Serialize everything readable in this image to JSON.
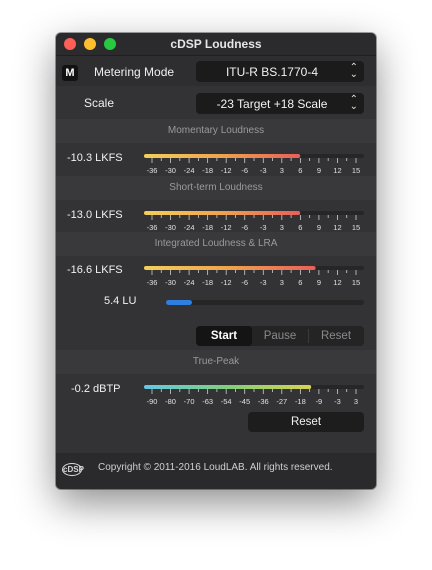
{
  "window": {
    "title": "cDSP Loudness"
  },
  "header": {
    "badge": "M",
    "metering_label": "Metering Mode",
    "metering_value": "ITU-R BS.1770-4",
    "scale_label": "Scale",
    "scale_value": "-23 Target +18 Scale"
  },
  "ebu_scale_ticks": [
    "-36",
    "-30",
    "-24",
    "-18",
    "-12",
    "-6",
    "-3",
    "3",
    "6",
    "9",
    "12",
    "15"
  ],
  "sections": {
    "momentary": {
      "title": "Momentary Loudness",
      "value": "-10.3 LKFS",
      "level": 0.71
    },
    "shortterm": {
      "title": "Short-term Loudness",
      "value": "-13.0 LKFS",
      "level": 0.71
    },
    "integrated": {
      "title": "Integrated Loudness & LRA",
      "value": "-16.6 LKFS",
      "level": 0.78
    }
  },
  "lra": {
    "value": "5.4 LU",
    "level": 0.13
  },
  "transport": {
    "start": "Start",
    "pause": "Pause",
    "reset": "Reset"
  },
  "truepeak": {
    "title": "True-Peak",
    "value": "-0.2 dBTP",
    "ticks": [
      "-90",
      "-80",
      "-70",
      "-63",
      "-54",
      "-45",
      "-36",
      "-27",
      "-18",
      "-9",
      "-3",
      "3"
    ],
    "level": 0.76,
    "reset": "Reset"
  },
  "footer": {
    "logo": "cDSP",
    "copyright": "Copyright © 2011-2016 LoudLAB. All rights reserved."
  },
  "colors": {
    "meter_gradient": [
      "#f2d05a",
      "#f0a24e",
      "#e85f5a"
    ],
    "truepeak_gradient": [
      "#63c8e6",
      "#7fd07a",
      "#d9d34c"
    ],
    "lra_bar": "#2f7fe0"
  }
}
